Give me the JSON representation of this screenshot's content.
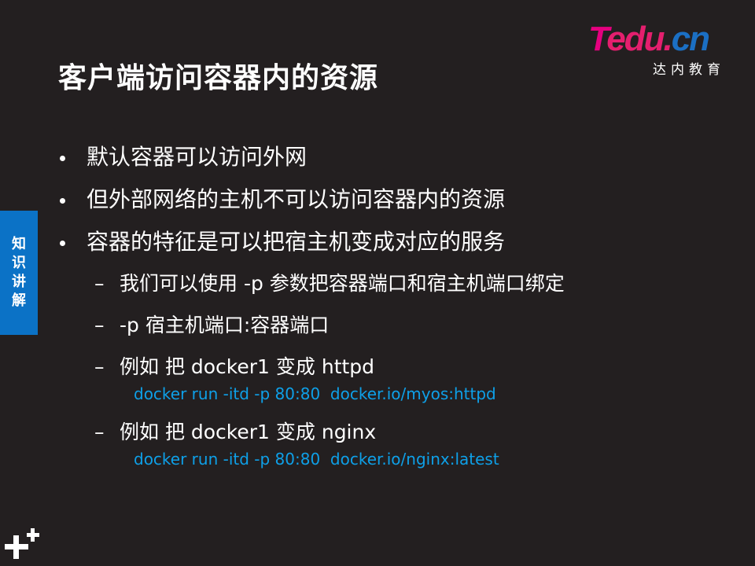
{
  "slide": {
    "title": "客户端访问容器内的资源",
    "side_tab": "知识讲解"
  },
  "logo": {
    "brand_t": "T",
    "brand_rest": "edu.",
    "brand_cn": "cn",
    "subtitle": "达内教育"
  },
  "bullets": [
    {
      "text": "默认容器可以访问外网"
    },
    {
      "text": "但外部网络的主机不可以访问容器内的资源"
    },
    {
      "text": "容器的特征是可以把宿主机变成对应的服务"
    }
  ],
  "sub_items": [
    {
      "dash": "–",
      "text": "我们可以使用 -p 参数把容器端口和宿主机端口绑定"
    },
    {
      "dash": "–",
      "text": "-p  宿主机端口:容器端口"
    },
    {
      "dash": "–",
      "text": "例如 把 docker1 变成 httpd"
    },
    {
      "dash": "–",
      "text": "例如 把 docker1 变成 nginx"
    }
  ],
  "code_lines": [
    "docker run -itd -p 80:80  docker.io/myos:httpd",
    "docker run -itd -p 80:80  docker.io/nginx:latest"
  ],
  "colors": {
    "background": "#231f20",
    "accent_blue": "#0b72c6",
    "code_text": "#0ea0e8",
    "logo_magenta": "#e5007f"
  }
}
